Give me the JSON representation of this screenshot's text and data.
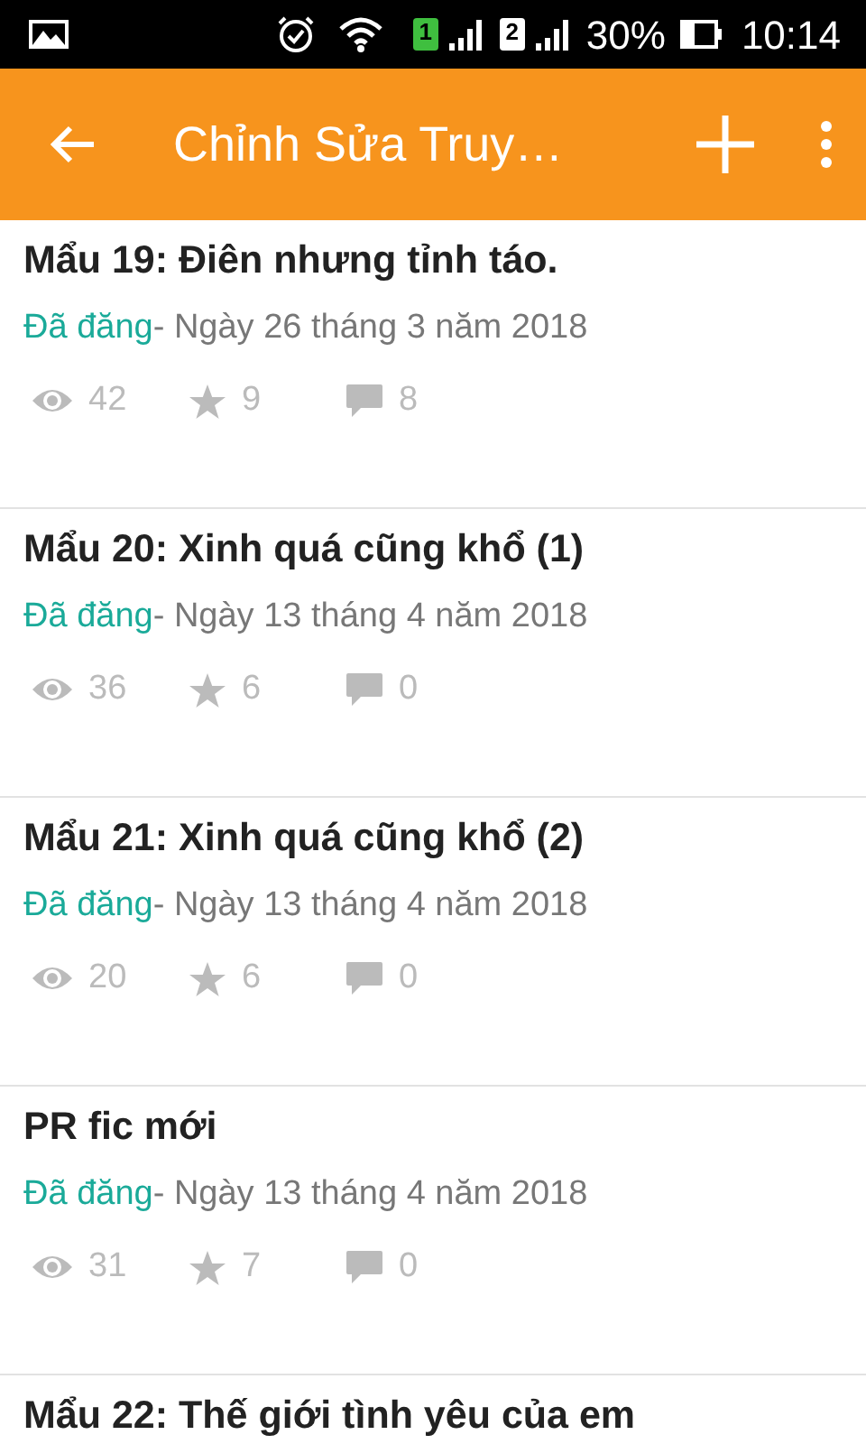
{
  "status_bar": {
    "sims": [
      {
        "number": "1",
        "color": "#3fbf3f"
      },
      {
        "number": "2",
        "color": "#ffffff"
      }
    ],
    "battery": "30%",
    "time": "10:14"
  },
  "app_bar": {
    "title": "Chỉnh Sửa Truy…"
  },
  "parts": [
    {
      "title": "Mẩu 19: Điên nhưng tỉnh táo.",
      "status": "Đã đăng",
      "date": "- Ngày 26 tháng 3 năm 2018",
      "views": "42",
      "votes": "9",
      "comments": "8"
    },
    {
      "title": "Mẩu 20: Xinh quá cũng khổ (1)",
      "status": "Đã đăng",
      "date": "- Ngày 13 tháng 4 năm 2018",
      "views": "36",
      "votes": "6",
      "comments": "0"
    },
    {
      "title": "Mẩu 21: Xinh quá cũng khổ (2)",
      "status": "Đã đăng",
      "date": "- Ngày 13 tháng 4 năm 2018",
      "views": "20",
      "votes": "6",
      "comments": "0"
    },
    {
      "title": "PR fic mới",
      "status": "Đã đăng",
      "date": "- Ngày 13 tháng 4 năm 2018",
      "views": "31",
      "votes": "7",
      "comments": "0"
    },
    {
      "title": "Mẩu 22: Thế giới tình yêu của em"
    }
  ]
}
